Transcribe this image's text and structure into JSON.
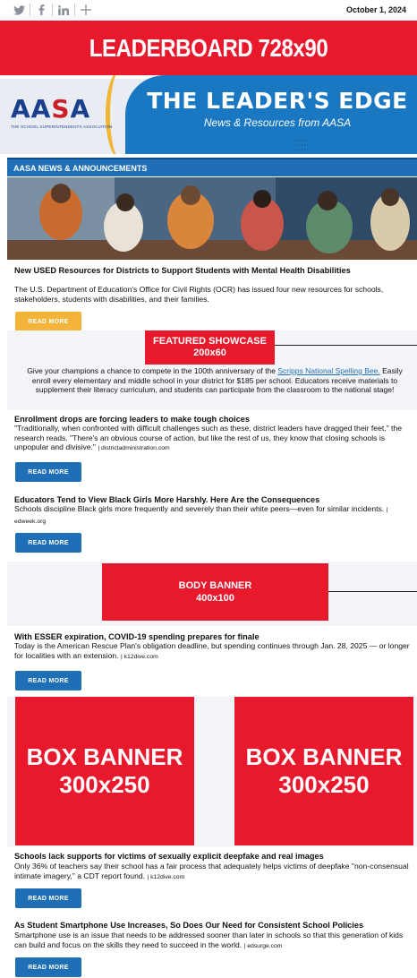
{
  "topbar": {
    "social_icons": [
      "twitter-icon",
      "facebook-icon",
      "linkedin-icon",
      "plus-icon"
    ],
    "date": "October 1, 2024"
  },
  "leaderboard": {
    "label": "LEADERBOARD 728x90",
    "color": "#e8192c"
  },
  "masthead": {
    "logo_text_left": "AA",
    "logo_text_red": "S",
    "logo_text_right": "A",
    "logo_subtitle": "THE SCHOOL SUPERINTENDENTS ASSOCIATION",
    "title": "THE LEADER'S EDGE",
    "subtitle": "News & Resources from AASA"
  },
  "section": {
    "heading": "AASA NEWS & ANNOUNCEMENTS"
  },
  "articles": [
    {
      "title": "New USED Resources for Districts to Support Students with Mental Health Disabilities",
      "body": "The U.S. Department of Education's Office for Civil Rights (OCR) has issued four new resources for schools, stakeholders, students with disabilities, and their families.",
      "button": "READ MORE"
    },
    {
      "title": "Enrollment drops are forcing leaders to make tough choices",
      "body": "\"Traditionally, when confronted with difficult challenges such as these, district leaders have dragged their feet,\" the research reads. \"There's an obvious course of action, but like the rest of us, they know that closing schools is unpopular and divisive.\"",
      "source": "| districtadministration.com",
      "button": "READ MORE"
    },
    {
      "title": "Educators Tend to View Black Girls More Harshly. Here Are the Consequences",
      "body": "Schools discipline Black girls more frequently and severely than their white peers—even for similar incidents.",
      "source": "| edweek.org",
      "button": "READ MORE"
    },
    {
      "title": "With ESSER expiration, COVID-19 spending prepares for finale",
      "body": "Today is the American Rescue Plan's obligation deadline, but spending continues through Jan. 28, 2025 — or longer for localities with an extension.",
      "source": "| k12dive.com",
      "button": "READ MORE"
    },
    {
      "title": "Schools lack supports for victims of sexually explicit deepfake and real images",
      "body": "Only 36% of teachers say their school has a fair process that adequately helps victims of deepfake \"non-consensual intimate imagery,\" a CDT report found.",
      "source": "| k12dive.com",
      "button": "READ MORE"
    },
    {
      "title": "As Student Smartphone Use Increases, So Does Our Need for Consistent School Policies",
      "body": "Smartphone use is an issue that needs to be addressed sooner than later in schools so that this generation of kids can build and focus on the skills they need to succeed in the world.",
      "source": "| edsurge.com",
      "button": "READ MORE"
    }
  ],
  "showcase": {
    "label_line1": "FEATURED SHOWCASE",
    "label_line2": "200x60",
    "text_before": "Give your champions a chance to compete in the 100th anniversary of the",
    "link": "Scripps National Spelling Bee.",
    "text_after": "Easily enroll every elementary and middle school in your district for $185 per school. Educators receive materials to supplement their literacy curriculum, and students can participate from the classroom to the national stage!"
  },
  "body_banner": {
    "line1": "BODY BANNER",
    "line2": "400x100"
  },
  "box_banners": [
    {
      "line1": "BOX BANNER",
      "line2": "300x250"
    },
    {
      "line1": "BOX BANNER",
      "line2": "300x250"
    }
  ]
}
